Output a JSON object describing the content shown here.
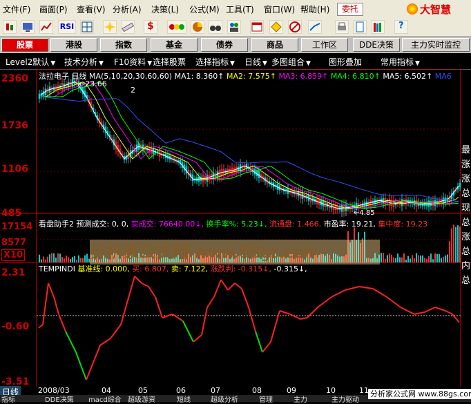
{
  "menu": {
    "items": [
      "文件(F)",
      "画面(P)",
      "查看(V)",
      "分析(A)",
      "决策(L)",
      "公式(M)",
      "工具(T)",
      "窗口(W)",
      "帮助(H)"
    ],
    "weituo": "委托",
    "brand": "大智慧"
  },
  "markets": {
    "tabs": [
      "股票",
      "港股",
      "指数",
      "基金",
      "债券",
      "商品"
    ],
    "workspace": "工作区",
    "dde": "DDE决策",
    "main_monitor": "主力实时监控"
  },
  "row2": {
    "items": [
      "Level2默认",
      "技术分析",
      "F10资料",
      "选择股票",
      "选择指标",
      "日线",
      "多图组合",
      "图形叠加",
      "常用指标"
    ]
  },
  "main": {
    "title": "法拉电子",
    "period": "日线",
    "ma_params": "MA(5,10,20,30,60,60)",
    "ma1": "MA1: 8.360↑",
    "ma2": "MA2: 7.575↑",
    "ma3": "MA3: 6.859↑",
    "ma4": "MA4: 6.810↑",
    "ma5": "MA5: 6.502↑",
    "ma6": "MA6",
    "axis": [
      "2360",
      "1736",
      "1106",
      "485"
    ],
    "high_label": "←23.66",
    "low_label": "←4.85",
    "marker": "2"
  },
  "volume": {
    "title": "看盘助手2",
    "predict": "预测成交: 0, 0,",
    "actual": "实成交: 76640.00↓,",
    "turnover": "换手率%: 5.23↓,",
    "float": "流通盘: 1.466,",
    "pe": "市盈率: 19.21,",
    "concentration": "集中度: 19.23",
    "axis": [
      "17154",
      "8577",
      "X10"
    ]
  },
  "indicator": {
    "name": "TEMPINDI",
    "base": "基准线: 0.000,",
    "buy": "买: 6.807,",
    "sell": "卖: 7.122,",
    "trend": "涨跌判: -0.315↓,",
    "last": "-0.315↓,",
    "axis": [
      "2.31",
      "-0.60",
      "-3.51"
    ]
  },
  "right_col": [
    "最",
    "涨",
    "涨",
    "总",
    "现",
    "总",
    "涨",
    "总",
    "内",
    "总"
  ],
  "dates": [
    "2008/03",
    "04",
    "05",
    "06",
    "07",
    "08",
    "09",
    "10",
    "11"
  ],
  "bottom": {
    "period": "日线",
    "tabs": [
      "指标",
      "DDE决策",
      "macd综合",
      "超级游资",
      "短线",
      "超级分析",
      "管理",
      "主力",
      "主力驱动"
    ],
    "site": "分析家公式网 www.88gs.com"
  },
  "watermark": "分析家公式网 www.88gs.com",
  "colors": {
    "up": "#ff3030",
    "down": "#00c000",
    "axis": "#c00000",
    "ma1": "#ffffff",
    "ma2": "#ffff00",
    "ma3": "#ff00ff",
    "ma4": "#00ff00",
    "ma5": "#3050ff"
  }
}
